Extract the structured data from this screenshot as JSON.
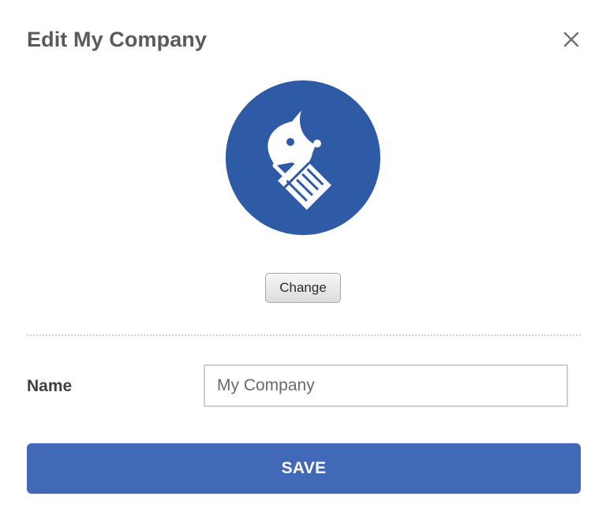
{
  "dialog": {
    "title": "Edit My Company",
    "close_icon": "close-icon",
    "logo": {
      "icon": "company-logo-icon",
      "background_color": "#2f5aa6"
    },
    "change_label": "Change",
    "name_field": {
      "label": "Name",
      "value": "My Company"
    },
    "save_label": "SAVE",
    "accent_color": "#4169b8"
  }
}
